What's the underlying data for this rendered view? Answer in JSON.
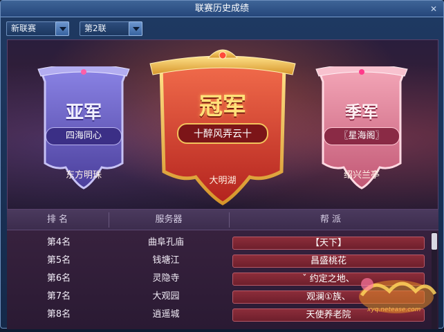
{
  "window": {
    "title": "联赛历史成绩",
    "close_icon": "close-icon"
  },
  "filters": {
    "league": {
      "selected": "新联赛"
    },
    "round": {
      "selected": "第2联"
    }
  },
  "podium": {
    "champion": {
      "rank_label": "冠军",
      "guild": "十醉风弄云十",
      "server": "大明湖",
      "color": "#d8412f"
    },
    "runner_up": {
      "rank_label": "亚军",
      "guild": "四海同心",
      "server": "东方明珠",
      "color": "#6a63c9"
    },
    "third": {
      "rank_label": "季军",
      "guild": "〖星海阁〗",
      "server": "绍兴兰亭",
      "color": "#e58aa0"
    }
  },
  "table": {
    "headers": {
      "rank": "排 名",
      "server": "服务器",
      "guild": "帮 派"
    },
    "rows": [
      {
        "rank": "第4名",
        "server": "曲阜孔庙",
        "guild": "【天下】"
      },
      {
        "rank": "第5名",
        "server": "钱塘江",
        "guild": "昌盛桃花"
      },
      {
        "rank": "第6名",
        "server": "灵隐寺",
        "guild": "ˇ 约定之地、"
      },
      {
        "rank": "第7名",
        "server": "大观园",
        "guild": "观澜①族、"
      },
      {
        "rank": "第8名",
        "server": "逍遥城",
        "guild": "天使养老院"
      }
    ]
  },
  "watermark": {
    "url": "xyq.netease.com"
  }
}
